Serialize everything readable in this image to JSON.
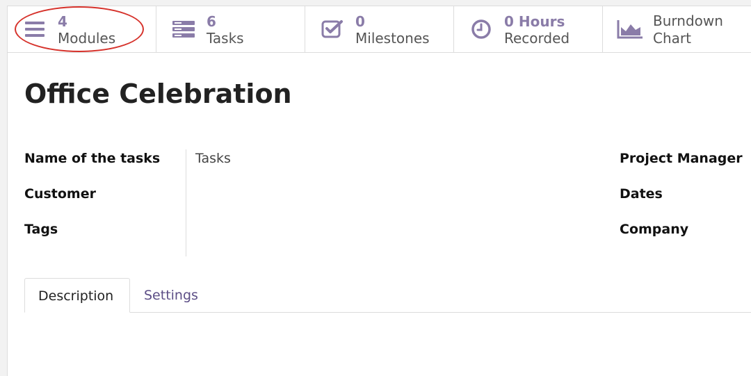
{
  "smart_buttons": [
    {
      "value": "4",
      "label": "Modules",
      "icon": "list-icon"
    },
    {
      "value": "6",
      "label": "Tasks",
      "icon": "tasks-icon"
    },
    {
      "value": "0",
      "label": "Milestones",
      "icon": "checkbox-icon"
    },
    {
      "value": "0 Hours",
      "label": "Recorded",
      "icon": "clock-icon"
    },
    {
      "label_line1": "Burndown",
      "label_line2": "Chart",
      "icon": "area-chart-icon"
    }
  ],
  "colors": {
    "accent": "#8a7ca8",
    "tab_link": "#5c4e86",
    "highlight": "#d6322b"
  },
  "project": {
    "title": "Office Celebration"
  },
  "fields_left": [
    {
      "label": "Name of the tasks",
      "value": "Tasks"
    },
    {
      "label": "Customer",
      "value": ""
    },
    {
      "label": "Tags",
      "value": ""
    }
  ],
  "fields_right": [
    {
      "label": "Project Manager"
    },
    {
      "label": "Dates"
    },
    {
      "label": "Company"
    }
  ],
  "tabs": [
    {
      "label": "Description",
      "active": true
    },
    {
      "label": "Settings",
      "active": false
    }
  ]
}
